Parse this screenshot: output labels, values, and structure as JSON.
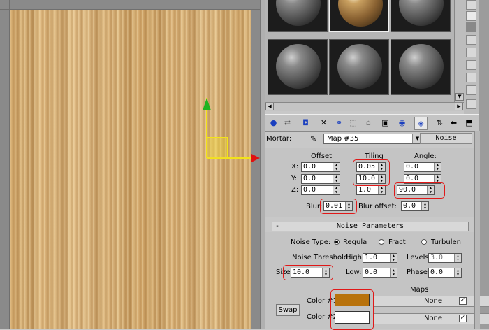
{
  "viewport": {
    "name": "perspective-viewport"
  },
  "slots": {
    "count": 6,
    "active_index": 1
  },
  "mortar": {
    "label": "Mortar:",
    "map_name": "Map #35",
    "type_button": "Noise"
  },
  "coords": {
    "offset_header": "Offset",
    "tiling_header": "Tiling",
    "angle_header": "Angle:",
    "x_label": "X:",
    "y_label": "Y:",
    "z_label": "Z:",
    "offset": {
      "x": "0.0",
      "y": "0.0",
      "z": "0.0"
    },
    "tiling": {
      "x": "0.05",
      "y": "10.0",
      "z": "1.0"
    },
    "angle": {
      "x": "0.0",
      "y": "0.0",
      "z": "90.0"
    },
    "blur_label": "Blur:",
    "blur_value": "0.01",
    "blur_offset_label": "Blur offset:",
    "blur_offset_value": "0.0"
  },
  "noise": {
    "section_title": "Noise Parameters",
    "collapse_symbol": "-",
    "noise_type_label": "Noise Type:",
    "types": [
      "Regula",
      "Fract",
      "Turbulen"
    ],
    "selected_type": "Regula",
    "threshold_label": "Noise Threshold:",
    "high_label": "High:",
    "high_value": "1.0",
    "low_label": "Low:",
    "low_value": "0.0",
    "levels_label": "Levels:",
    "levels_value": "3.0",
    "phase_label": "Phase:",
    "phase_value": "0.0",
    "size_label": "Size:",
    "size_value": "10.0",
    "maps_label": "Maps",
    "color1_label": "Color #1",
    "color1_hex": "#b8720c",
    "color2_label": "Color #2",
    "color2_hex": "#ffffff",
    "map1_button": "None",
    "map2_button": "None",
    "swap_button": "Swap"
  },
  "colors": {
    "highlight_red": "#e01818",
    "gizmo_yellow": "#f2e21a",
    "axis_green": "#1fb31f",
    "axis_red": "#e01010"
  }
}
